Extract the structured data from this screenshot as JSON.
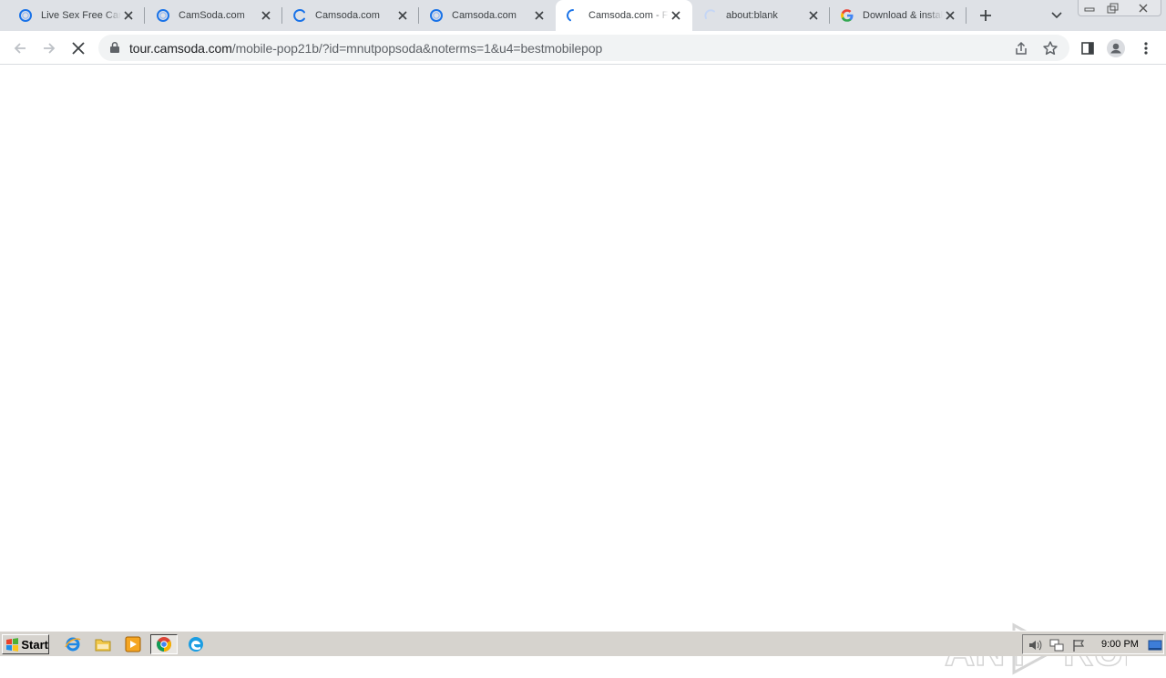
{
  "tabs": [
    {
      "title": "Live Sex Free Cam",
      "favicon": "camsoda-ring-icon",
      "active": false
    },
    {
      "title": "CamSoda.com",
      "favicon": "camsoda-ring-icon",
      "active": false
    },
    {
      "title": "Camsoda.com",
      "favicon": "loading-spinner-icon",
      "active": false
    },
    {
      "title": "Camsoda.com",
      "favicon": "camsoda-ring-icon",
      "active": false
    },
    {
      "title": "Camsoda.com - Fr",
      "favicon": "loading-spinner-icon",
      "active": true
    },
    {
      "title": "about:blank",
      "favicon": "loading-spinner-faint-icon",
      "active": false
    },
    {
      "title": "Download & install",
      "favicon": "google-g-icon",
      "active": false
    }
  ],
  "address_bar": {
    "host": "tour.camsoda.com",
    "path": "/mobile-pop21b/?id=mnutpopsoda&noterms=1&u4=bestmobilepop"
  },
  "watermark": {
    "text_left": "ANY",
    "text_right": "RUN"
  },
  "taskbar": {
    "start_label": "Start",
    "clock": "9:00 PM"
  },
  "colors": {
    "accent": "#1a73e8",
    "tabstrip": "#dee1e6",
    "omnibox": "#f1f3f4",
    "taskbar": "#d6d3ce"
  }
}
